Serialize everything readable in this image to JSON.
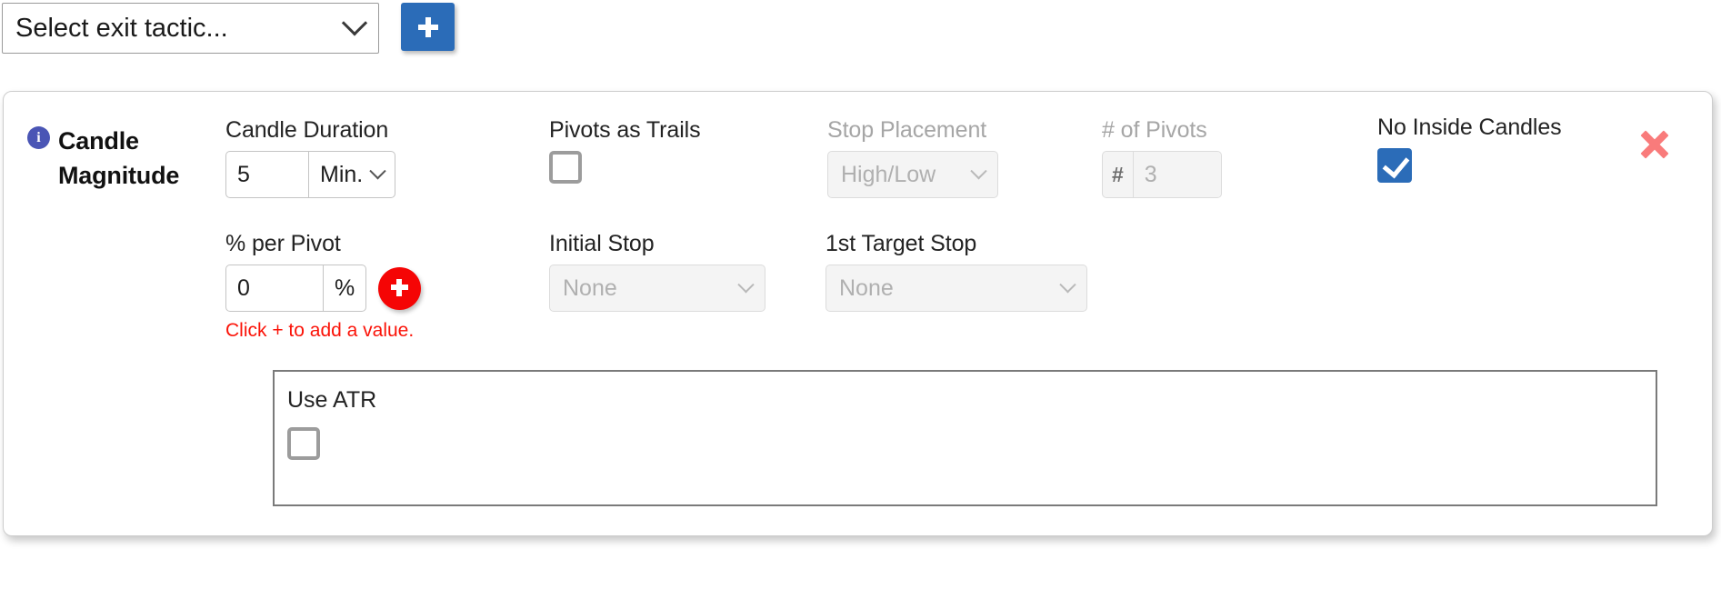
{
  "topbar": {
    "tactic_select": {
      "value": "Select exit tactic...",
      "icon": "chevron-down-icon"
    },
    "add_button": {
      "icon": "plus-icon",
      "label": "+",
      "color": "#2b6cb8"
    }
  },
  "card": {
    "info_icon": "i",
    "title": "Candle Magnitude",
    "close_icon": "close-x-icon",
    "close_color": "#f97b7b",
    "fields": {
      "candle_duration": {
        "label": "Candle Duration",
        "value": "5",
        "unit": "Min.",
        "unit_icon": "chevron-down-icon",
        "disabled": false
      },
      "pivots_as_trails": {
        "label": "Pivots as Trails",
        "checked": false,
        "disabled": false
      },
      "stop_placement": {
        "label": "Stop Placement",
        "value": "High/Low",
        "icon": "chevron-down-icon",
        "disabled": true
      },
      "num_pivots": {
        "label": "# of Pivots",
        "prefix": "#",
        "value": "3",
        "disabled": true
      },
      "no_inside_candles": {
        "label": "No Inside Candles",
        "checked": true,
        "color": "#2b6cb8"
      },
      "percent_per_pivot": {
        "label": "% per Pivot",
        "value": "0",
        "unit": "%",
        "add_icon": "plus-icon",
        "add_color": "#f50505",
        "hint": "Click + to add a value.",
        "hint_color": "#fb1308"
      },
      "initial_stop": {
        "label": "Initial Stop",
        "value": "None",
        "icon": "chevron-down-icon",
        "disabled": true
      },
      "first_target_stop": {
        "label": "1st Target Stop",
        "value": "None",
        "icon": "chevron-down-icon",
        "disabled": true
      },
      "use_atr": {
        "label": "Use ATR",
        "checked": false
      }
    }
  }
}
